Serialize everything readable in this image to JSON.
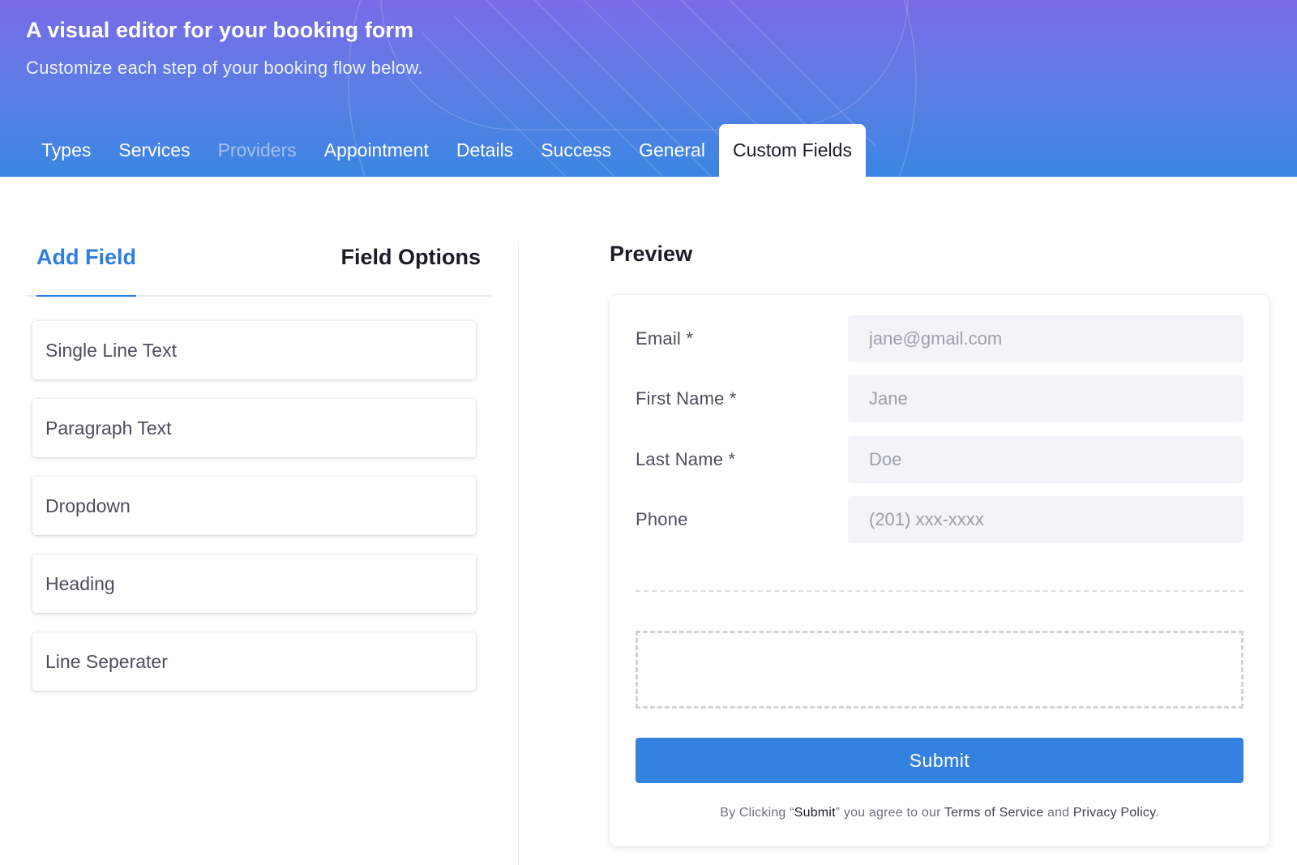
{
  "header": {
    "title": "A visual editor for your booking form",
    "subtitle": "Customize each step of your booking flow below.",
    "tabs": [
      {
        "label": "Types",
        "state": "normal"
      },
      {
        "label": "Services",
        "state": "normal"
      },
      {
        "label": "Providers",
        "state": "disabled"
      },
      {
        "label": "Appointment",
        "state": "normal"
      },
      {
        "label": "Details",
        "state": "normal"
      },
      {
        "label": "Success",
        "state": "normal"
      },
      {
        "label": "General",
        "state": "normal"
      },
      {
        "label": "Custom Fields",
        "state": "active"
      }
    ]
  },
  "left_panel": {
    "tabs": {
      "add_field": "Add Field",
      "field_options": "Field Options"
    },
    "field_types": [
      "Single Line Text",
      "Paragraph Text",
      "Dropdown",
      "Heading",
      "Line Seperater"
    ]
  },
  "preview": {
    "title": "Preview",
    "fields": [
      {
        "label": "Email *",
        "placeholder": "jane@gmail.com"
      },
      {
        "label": "First Name *",
        "placeholder": "Jane"
      },
      {
        "label": "Last Name *",
        "placeholder": "Doe"
      },
      {
        "label": "Phone",
        "placeholder": "(201) xxx-xxxx"
      }
    ],
    "submit_label": "Submit",
    "terms": {
      "prefix": "By Clicking “",
      "submit_word": "Submit",
      "middle": "” you agree to our ",
      "terms_link": "Terms of Service",
      "and": " and ",
      "privacy_link": "Privacy Policy",
      "suffix": "."
    }
  },
  "colors": {
    "accent": "#3482e0",
    "header_gradient_top": "#7a6be6",
    "header_gradient_bottom": "#3a86e2"
  }
}
